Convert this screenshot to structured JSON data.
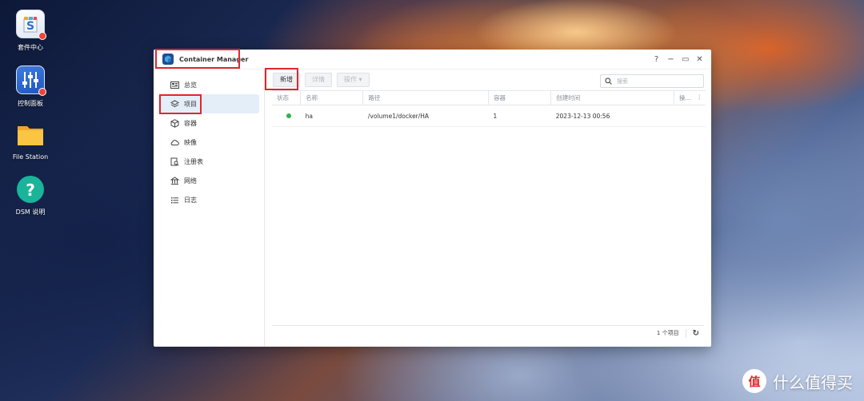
{
  "desktop": {
    "icons": [
      {
        "label": "套件中心",
        "icon": "package-center-icon",
        "badge": true
      },
      {
        "label": "控制面板",
        "icon": "control-panel-icon",
        "badge": true
      },
      {
        "label": "File Station",
        "icon": "folder-icon",
        "badge": false
      },
      {
        "label": "DSM 说明",
        "icon": "help-icon",
        "badge": false
      }
    ]
  },
  "window": {
    "title": "Container Manager",
    "controls": {
      "help": "?",
      "minimize": "−",
      "maximize": "▭",
      "close": "✕"
    }
  },
  "sidebar": {
    "items": [
      {
        "label": "总览",
        "icon": "overview-icon"
      },
      {
        "label": "项目",
        "icon": "layers-icon",
        "active": true
      },
      {
        "label": "容器",
        "icon": "cube-icon"
      },
      {
        "label": "映像",
        "icon": "cloud-icon"
      },
      {
        "label": "注册表",
        "icon": "registry-icon"
      },
      {
        "label": "网络",
        "icon": "network-icon"
      },
      {
        "label": "日志",
        "icon": "list-icon"
      }
    ]
  },
  "toolbar": {
    "create_label": "新增",
    "details_label": "详情",
    "action_label": "操作 ▾",
    "search_placeholder": "搜索"
  },
  "table": {
    "headers": [
      "状态",
      "名称",
      "路径",
      "容器",
      "创建时间",
      "操..."
    ],
    "more_icon": "⋮",
    "rows": [
      {
        "status": "running",
        "name": "ha",
        "path": "/volume1/docker/HA",
        "containers": "1",
        "created": "2023-12-13 00:56"
      }
    ]
  },
  "footer": {
    "count_label": "1 个项目",
    "refresh_icon": "↻"
  },
  "watermark": {
    "logo_text": "值",
    "text": "什么值得买"
  },
  "colors": {
    "accent_red": "#e0262b",
    "status_green": "#2db34a",
    "active_nav": "#e4eef9"
  }
}
